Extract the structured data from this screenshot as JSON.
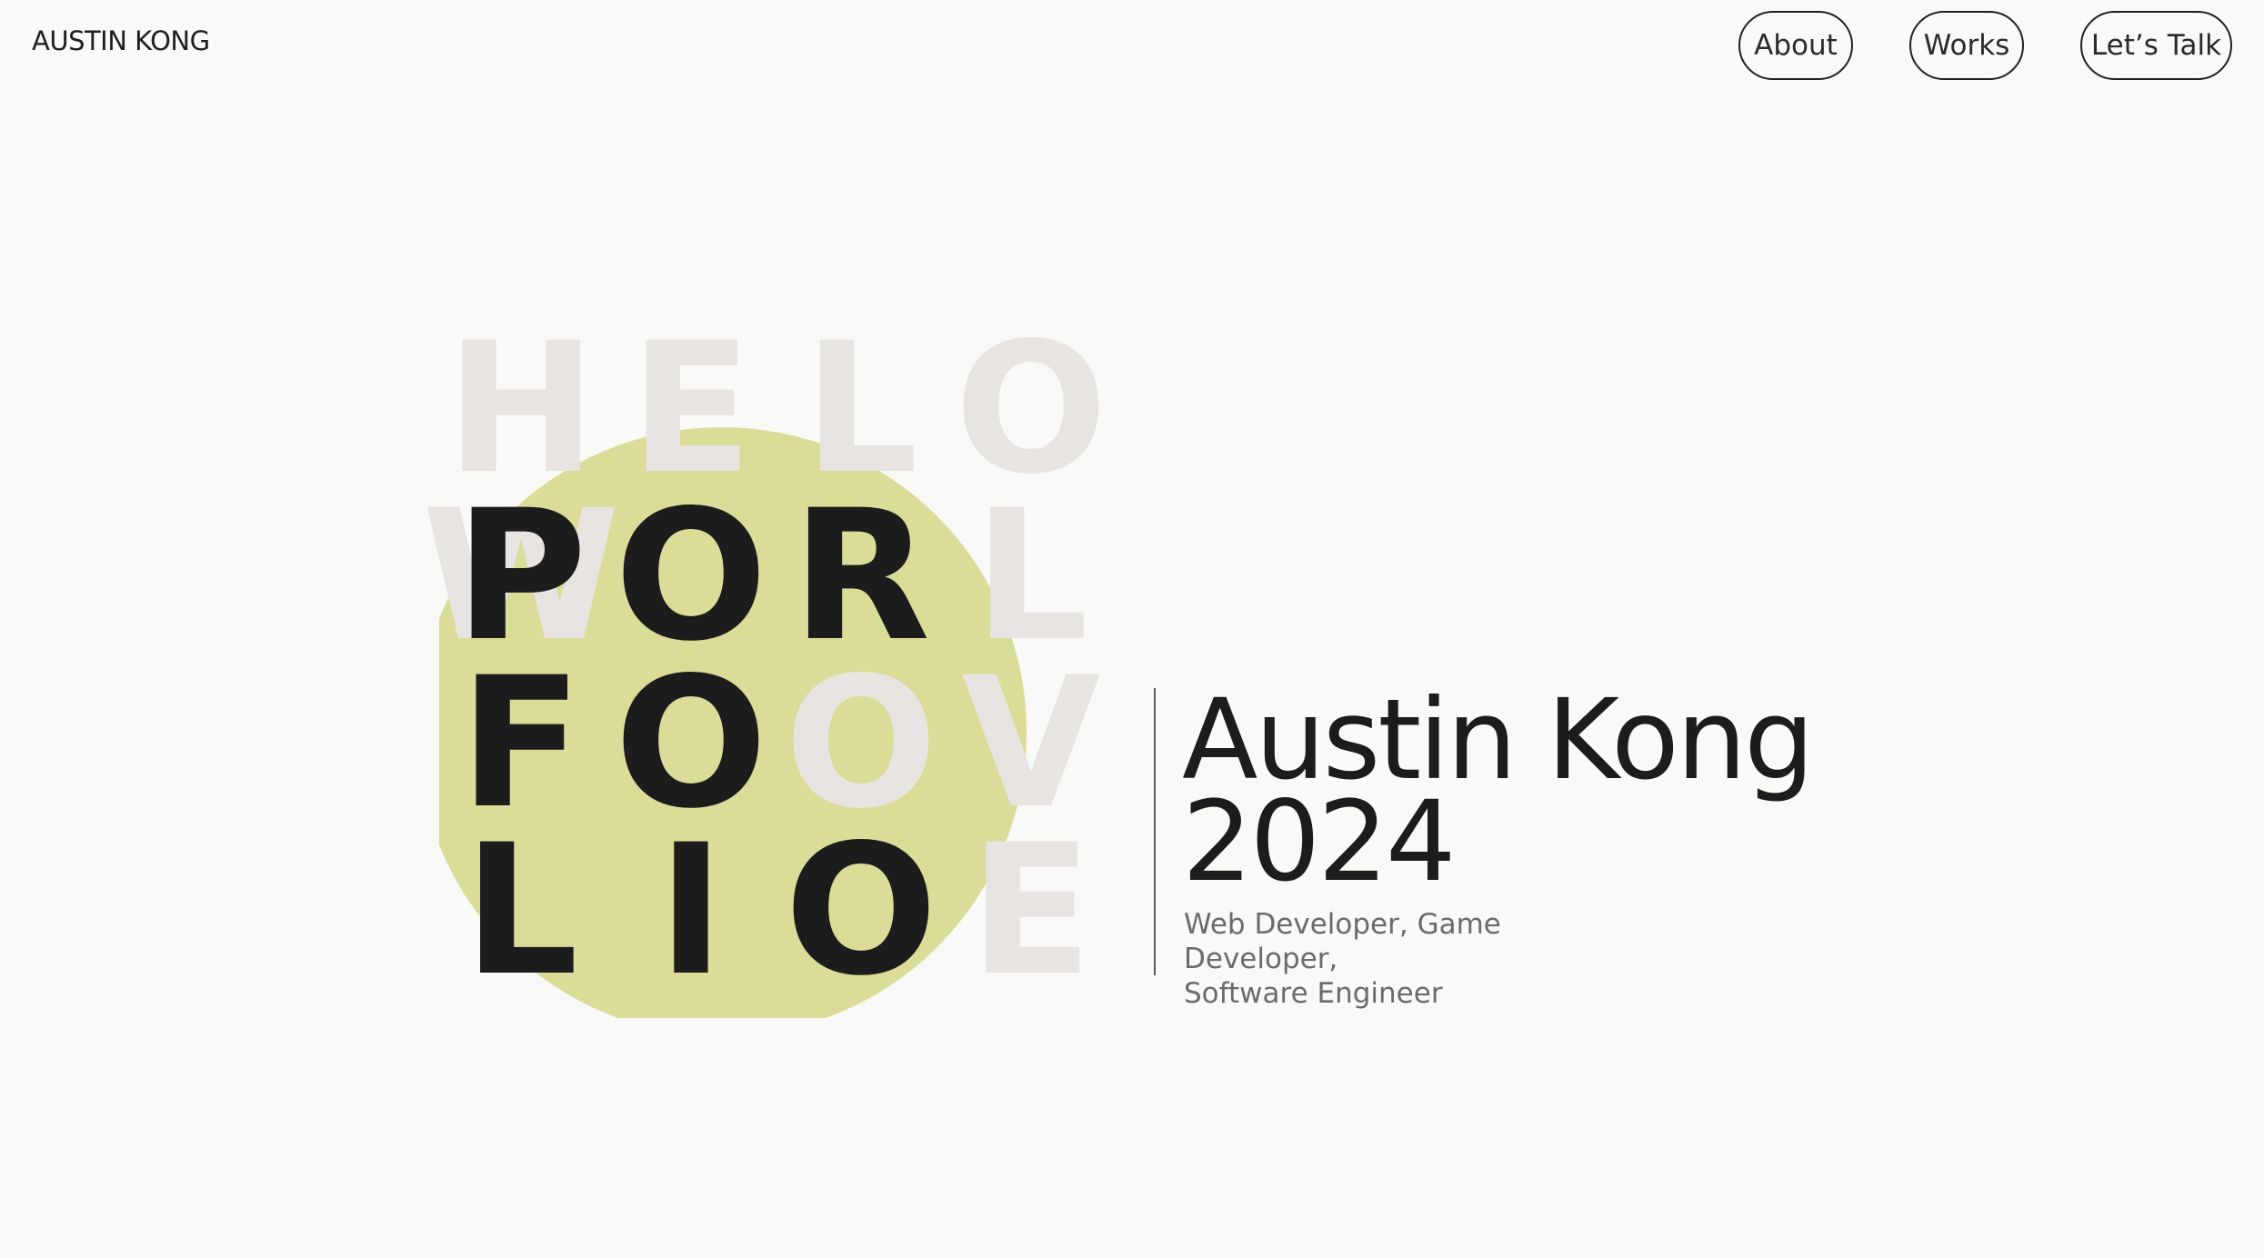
{
  "header": {
    "brand": "AUSTIN KONG",
    "nav": [
      {
        "label": "About"
      },
      {
        "label": "Works"
      },
      {
        "label": "Let’s Talk"
      }
    ]
  },
  "hero": {
    "ghost_letters": {
      "row1": [
        "H",
        "E",
        "L",
        "O"
      ],
      "row2": [
        "W",
        "",
        "",
        "L"
      ],
      "row3": [
        "",
        "",
        "O",
        "V"
      ],
      "row4": [
        "",
        "",
        "",
        "E"
      ]
    },
    "dark_letters": {
      "row2": [
        "P",
        "O",
        "R"
      ],
      "row3": [
        "F",
        "O"
      ],
      "row4": [
        "L",
        "I",
        "O"
      ]
    },
    "name": "Austin Kong",
    "year": "2024",
    "roles_line1": "Web Developer, Game Developer,",
    "roles_line2": "Software Engineer"
  },
  "colors": {
    "background": "#f9f9f8",
    "accent_circle": "#dbdc97",
    "ghost_letter": "#e7e4e2",
    "text_dark": "#1c1c1c"
  }
}
